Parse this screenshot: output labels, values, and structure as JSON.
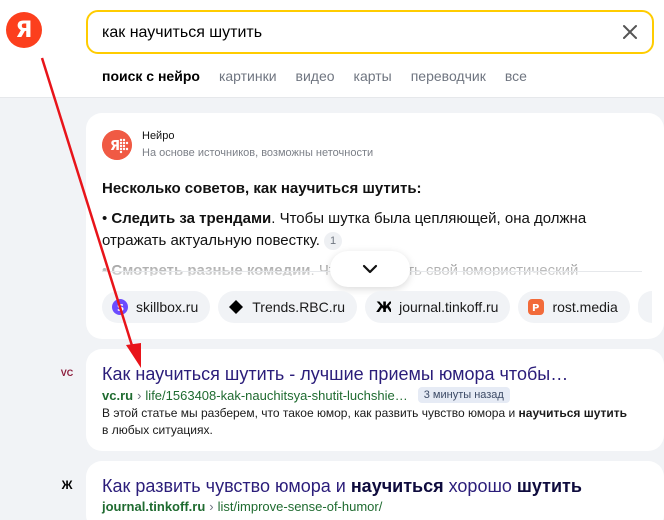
{
  "header": {
    "logo_text": "Я",
    "search": {
      "value": "как научиться шутить",
      "placeholder": ""
    },
    "tabs": [
      {
        "label": "поиск с нейро",
        "active": true
      },
      {
        "label": "картинки",
        "active": false
      },
      {
        "label": "видео",
        "active": false
      },
      {
        "label": "карты",
        "active": false
      },
      {
        "label": "переводчик",
        "active": false
      },
      {
        "label": "все",
        "active": false
      }
    ]
  },
  "neuro": {
    "title": "Нейро",
    "subtitle": "На основе источников, возможны неточности",
    "heading": "Несколько советов, как научиться шутить:",
    "tip1_bold": "Следить за трендами",
    "tip1_text": ". Чтобы шутка была цепляющей, она должна отражать актуальную повестку.",
    "tip1_ref": "1",
    "tip2_bold": "Смотреть разные комедии",
    "tip2_text": ". Чтобы развить свой юмористический",
    "sources": [
      {
        "label": "skillbox.ru",
        "icon": "skillbox-icon",
        "color": "#6b4cff"
      },
      {
        "label": "Trends.RBC.ru",
        "icon": "rbc-diamond-icon",
        "color": "#000000"
      },
      {
        "label": "journal.tinkoff.ru",
        "icon": "tinkoff-journal-icon",
        "color": "#000000"
      },
      {
        "label": "rost.media",
        "icon": "rost-media-icon",
        "color": "#f26b3a"
      }
    ]
  },
  "results": [
    {
      "favicon": "VC",
      "title_bold": "Как научиться шутить",
      "title_rest": " - лучшие приемы юмора чтобы…",
      "domain": "vc.ru",
      "path": "life/1563408-kak-nauchitsya-shutit-luchshie…",
      "time": "3 минуты назад",
      "snippet_a": "В этой статье мы разберем, что такое юмор, как развить чувство юмора и ",
      "snippet_b": "научиться шутить",
      "snippet_c": " в любых ситуациях."
    },
    {
      "favicon": "Ж",
      "title_a": "Как развить чувство юмора и ",
      "title_b": "научиться",
      "title_c": " хорошо ",
      "title_d": "шутить",
      "domain": "journal.tinkoff.ru",
      "path": "list/improve-sense-of-humor/"
    }
  ],
  "colors": {
    "accent_yellow": "#ffcc00",
    "logo_red": "#fc3f1d",
    "arrow_red": "#e8141a",
    "link_purple": "#2b1d7a",
    "url_green": "#1f6b30"
  }
}
